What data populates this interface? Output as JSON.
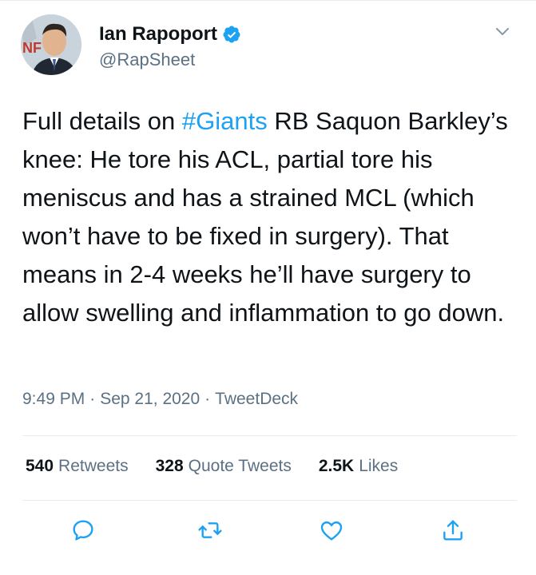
{
  "author": {
    "display_name": "Ian Rapoport",
    "handle": "@RapSheet",
    "verified": true,
    "avatar_icon": "profile-photo"
  },
  "tweet": {
    "text_before_hashtag": "Full details on ",
    "hashtag": "#Giants",
    "text_after_hashtag": " RB Saquon Barkley’s knee: He tore his ACL, partial tore his meniscus and has a strained MCL (which won’t have to be fixed in surgery). That means in 2-4 weeks he’ll have surgery to allow swelling and inflammation to go down."
  },
  "meta": {
    "time": "9:49 PM",
    "separator": "·",
    "date": "Sep 21, 2020",
    "source": "TweetDeck"
  },
  "stats": {
    "retweets_count": "540",
    "retweets_label": "Retweets",
    "quotes_count": "328",
    "quotes_label": "Quote Tweets",
    "likes_count": "2.5K",
    "likes_label": "Likes"
  },
  "colors": {
    "link_blue": "#1da1f2",
    "secondary_text": "#5b7083",
    "divider": "#e6ecf0"
  },
  "icons": [
    "verified-badge-icon",
    "chevron-down-icon",
    "reply-icon",
    "retweet-icon",
    "like-icon",
    "share-icon"
  ]
}
